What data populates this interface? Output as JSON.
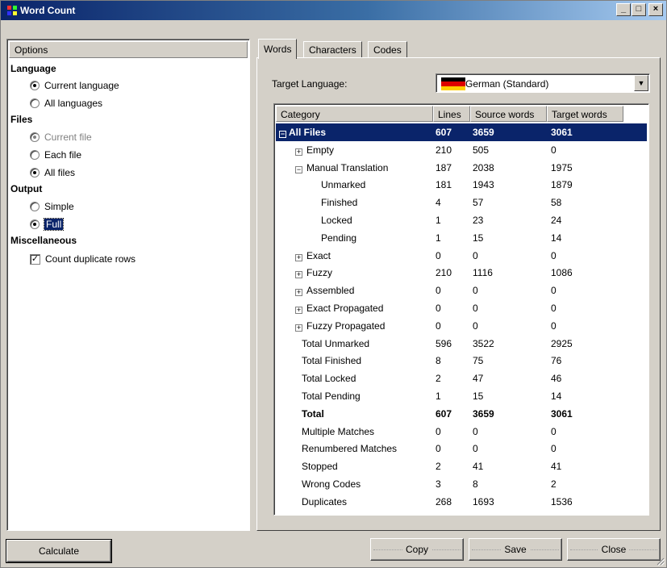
{
  "window": {
    "title": "Word Count",
    "minimize": "_",
    "maximize": "□",
    "close": "×"
  },
  "options": {
    "header": "Options",
    "language": {
      "title": "Language",
      "items": [
        "Current language",
        "All languages"
      ]
    },
    "files": {
      "title": "Files",
      "items": [
        "Current file",
        "Each file",
        "All files"
      ]
    },
    "output": {
      "title": "Output",
      "items": [
        "Simple",
        "Full"
      ]
    },
    "misc": {
      "title": "Miscellaneous",
      "items": [
        "Count duplicate rows"
      ]
    }
  },
  "tabs": [
    "Words",
    "Characters",
    "Codes"
  ],
  "target": {
    "label": "Target Language:",
    "value": "German (Standard)",
    "flag_colors": [
      "#000000",
      "#dd0000",
      "#ffce00"
    ]
  },
  "table": {
    "columns": [
      "Category",
      "Lines",
      "Source words",
      "Target words"
    ],
    "rows": [
      {
        "category": "All Files",
        "lines": "607",
        "source": "3659",
        "target": "3061"
      },
      {
        "category": "Empty",
        "lines": "210",
        "source": "505",
        "target": "0"
      },
      {
        "category": "Manual Translation",
        "lines": "187",
        "source": "2038",
        "target": "1975"
      },
      {
        "category": "Unmarked",
        "lines": "181",
        "source": "1943",
        "target": "1879"
      },
      {
        "category": "Finished",
        "lines": "4",
        "source": "57",
        "target": "58"
      },
      {
        "category": "Locked",
        "lines": "1",
        "source": "23",
        "target": "24"
      },
      {
        "category": "Pending",
        "lines": "1",
        "source": "15",
        "target": "14"
      },
      {
        "category": "Exact",
        "lines": "0",
        "source": "0",
        "target": "0"
      },
      {
        "category": "Fuzzy",
        "lines": "210",
        "source": "1116",
        "target": "1086"
      },
      {
        "category": "Assembled",
        "lines": "0",
        "source": "0",
        "target": "0"
      },
      {
        "category": "Exact Propagated",
        "lines": "0",
        "source": "0",
        "target": "0"
      },
      {
        "category": "Fuzzy Propagated",
        "lines": "0",
        "source": "0",
        "target": "0"
      },
      {
        "category": "Total Unmarked",
        "lines": "596",
        "source": "3522",
        "target": "2925"
      },
      {
        "category": "Total Finished",
        "lines": "8",
        "source": "75",
        "target": "76"
      },
      {
        "category": "Total Locked",
        "lines": "2",
        "source": "47",
        "target": "46"
      },
      {
        "category": "Total Pending",
        "lines": "1",
        "source": "15",
        "target": "14"
      },
      {
        "category": "Total",
        "lines": "607",
        "source": "3659",
        "target": "3061"
      },
      {
        "category": "Multiple Matches",
        "lines": "0",
        "source": "0",
        "target": "0"
      },
      {
        "category": "Renumbered Matches",
        "lines": "0",
        "source": "0",
        "target": "0"
      },
      {
        "category": "Stopped",
        "lines": "2",
        "source": "41",
        "target": "41"
      },
      {
        "category": "Wrong Codes",
        "lines": "3",
        "source": "8",
        "target": "2"
      },
      {
        "category": "Duplicates",
        "lines": "268",
        "source": "1693",
        "target": "1536"
      }
    ]
  },
  "buttons": {
    "calculate": "Calculate",
    "copy": "Copy",
    "save": "Save",
    "close": "Close"
  },
  "colors": {
    "selection": "#0a246a",
    "face": "#d4d0c8"
  }
}
